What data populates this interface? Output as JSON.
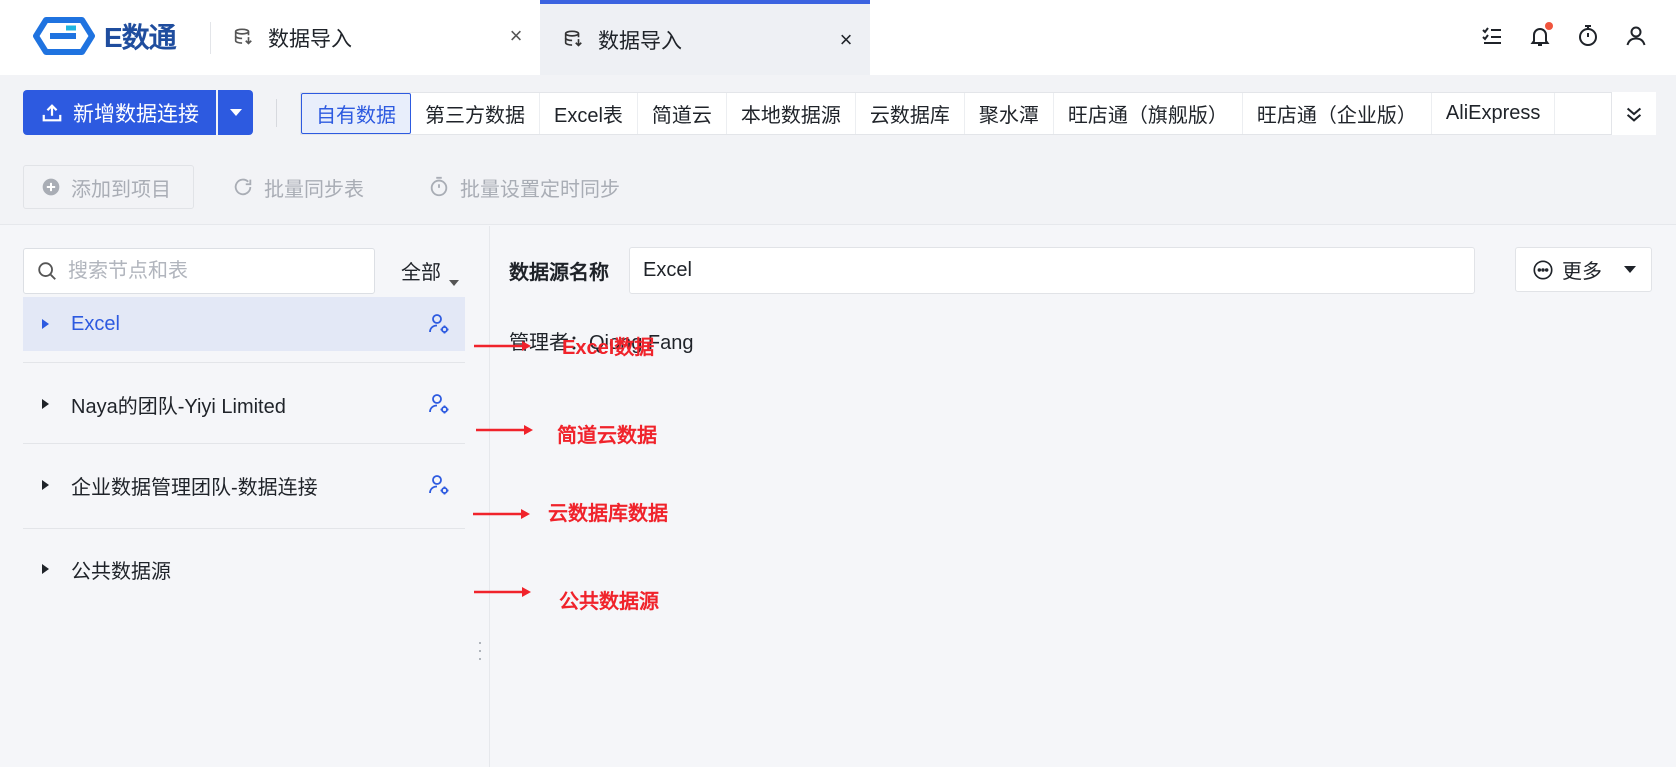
{
  "app": {
    "logo_text": "E数通",
    "brand_color": "#1f4d9e",
    "accent": "#2d5ae0"
  },
  "tabs": [
    {
      "label": "数据导入",
      "icon": "database-icon",
      "active": false
    },
    {
      "label": "数据导入",
      "icon": "database-icon",
      "active": true
    }
  ],
  "header_icons": [
    "task-list-icon",
    "bell-icon",
    "timer-icon",
    "user-icon"
  ],
  "toolbar": {
    "new_connection_label": "新增数据连接",
    "source_tabs": [
      "自有数据",
      "第三方数据",
      "Excel表",
      "简道云",
      "本地数据源",
      "云数据库",
      "聚水潭",
      "旺店通（旗舰版）",
      "旺店通（企业版）",
      "AliExpress"
    ],
    "active_source_tab": "自有数据",
    "actions": {
      "add_to_project": "添加到项目",
      "batch_sync": "批量同步表",
      "batch_schedule": "批量设置定时同步"
    }
  },
  "tree": {
    "search_placeholder": "搜索节点和表",
    "filter_label": "全部",
    "nodes": [
      {
        "label": "Excel",
        "selected": true,
        "has_permission_icon": true
      },
      {
        "label": "Naya的团队-Yiyi Limited",
        "selected": false,
        "has_permission_icon": true
      },
      {
        "label": "企业数据管理团队-数据连接",
        "selected": false,
        "has_permission_icon": true
      },
      {
        "label": "公共数据源",
        "selected": false,
        "has_permission_icon": false
      }
    ]
  },
  "detail": {
    "name_label": "数据源名称",
    "name_value": "Excel",
    "more_label": "更多",
    "manager_text": "管理者：Qiong Fang"
  },
  "annotations": {
    "color": "#f0232b",
    "items": [
      "Excel数据",
      "简道云数据",
      "云数据库数据",
      "公共数据源"
    ]
  }
}
